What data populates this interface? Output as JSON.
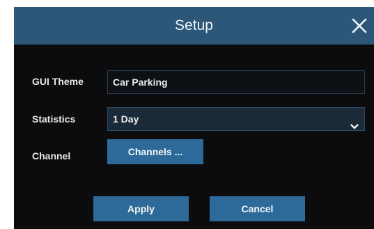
{
  "dialog": {
    "title": "Setup",
    "close_icon": "close-icon"
  },
  "form": {
    "gui_theme": {
      "label": "GUI Theme",
      "value": "Car Parking"
    },
    "statistics": {
      "label": "Statistics",
      "value": "1 Day",
      "icon": "chevron-down-icon"
    },
    "channel": {
      "label": "Channel",
      "button_label": "Channels ..."
    }
  },
  "actions": {
    "apply_label": "Apply",
    "cancel_label": "Cancel"
  },
  "colors": {
    "titlebar": "#2c5778",
    "dialog_bg": "#0c0c0f",
    "button": "#2d6a99"
  }
}
